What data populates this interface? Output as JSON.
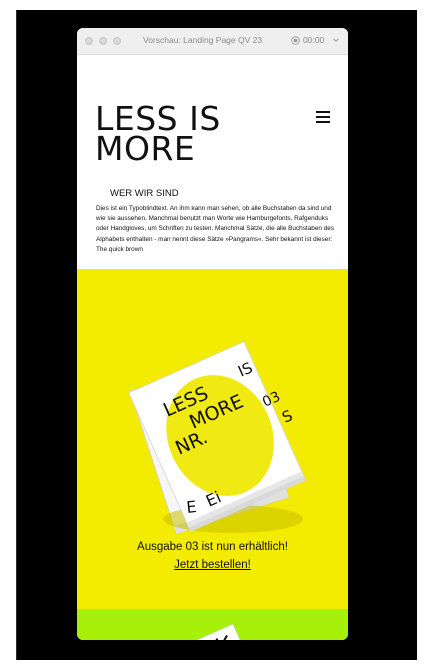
{
  "window": {
    "title": "Vorschau: Landing Page QV 23",
    "timer": "00:00"
  },
  "hero": {
    "line1": "LESS IS",
    "line2": "MORE"
  },
  "about": {
    "heading": "WER WIR SIND",
    "body": "Dies ist ein Typoblindtext. An ihm kann man sehen, ob alle Buchstaben da sind und wie sie aussehen. Manchmal benutzt man Worte wie Hamburgefonts, Rafgenduks oder Handgloves, um Schriften zu testen. Manchmal Sätze, die alle Buchstaben des Alphabets enthalten - man nennt diese Sätze »Pangrams«. Sehr bekannt ist dieser: The quick brown"
  },
  "magazine": {
    "cover_lines": [
      "LESS",
      "MORE",
      "NR.",
      "03",
      "IS",
      "S",
      "E",
      "Ei"
    ]
  },
  "promo": {
    "text": "Ausgabe 03 ist nun erhältlich!",
    "link": "Jetzt bestellen!"
  },
  "colors": {
    "yellow": "#f4ec00",
    "green": "#a7f00a"
  },
  "icons": [
    "record-icon",
    "chevron-down-icon",
    "menu-icon",
    "magazine-stack-icon"
  ]
}
